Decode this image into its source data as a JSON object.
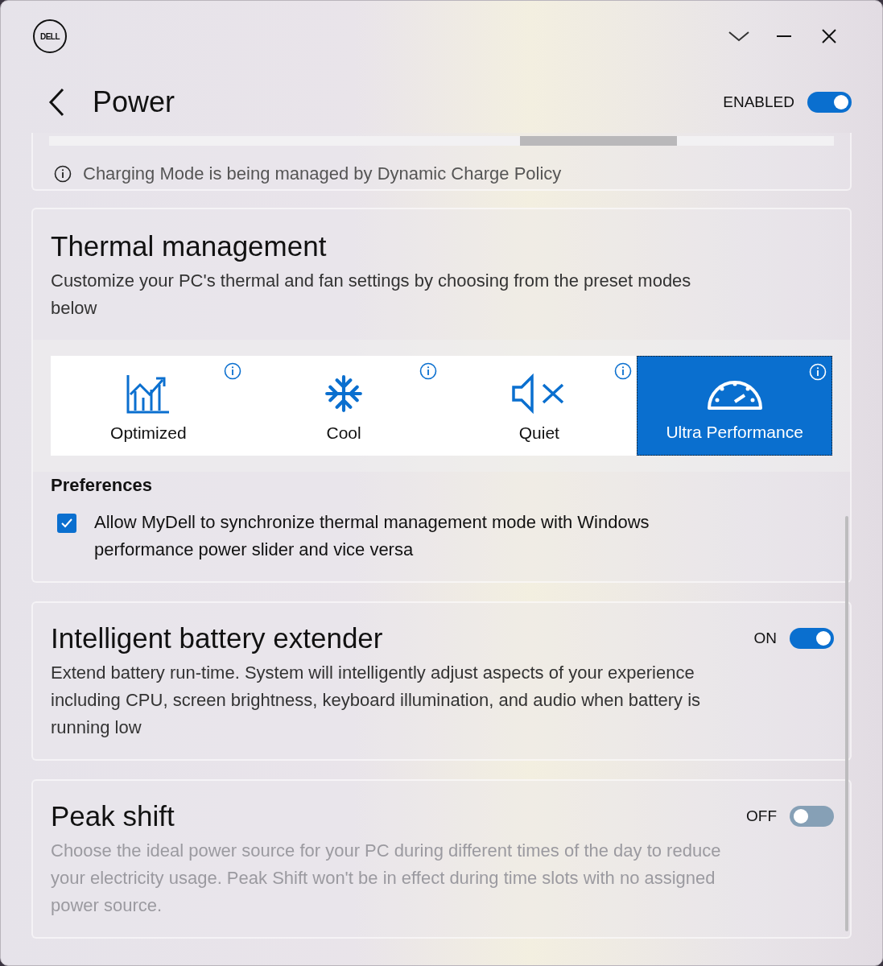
{
  "window": {
    "logo": "DELL",
    "title": "Power",
    "enabled_label": "ENABLED",
    "enabled": true
  },
  "charging": {
    "segments": [
      {
        "selected": false
      },
      {
        "selected": false
      },
      {
        "selected": false
      },
      {
        "selected": true
      },
      {
        "selected": false
      }
    ],
    "note": "Charging Mode is being managed by Dynamic Charge Policy"
  },
  "thermal": {
    "title": "Thermal management",
    "description": "Customize your PC's thermal and fan settings by choosing from the preset modes below",
    "modes": [
      {
        "label": "Optimized",
        "selected": false
      },
      {
        "label": "Cool",
        "selected": false
      },
      {
        "label": "Quiet",
        "selected": false
      },
      {
        "label": "Ultra Performance",
        "selected": true
      }
    ],
    "preferences_title": "Preferences",
    "sync": {
      "label": "Allow MyDell to synchronize thermal management mode with Windows performance power slider and vice versa",
      "checked": true
    }
  },
  "sections": [
    {
      "title": "Intelligent battery extender",
      "toggle_label": "ON",
      "on": true,
      "disabled": false,
      "description": "Extend battery run-time. System will intelligently adjust aspects of your experience including CPU, screen brightness, keyboard illumination, and audio when battery is running low"
    },
    {
      "title": "Peak shift",
      "toggle_label": "OFF",
      "on": false,
      "disabled": true,
      "description": "Choose the ideal power source for your PC during different times of the day to reduce your electricity usage. Peak Shift won't be in effect during time slots with no assigned power source."
    }
  ]
}
